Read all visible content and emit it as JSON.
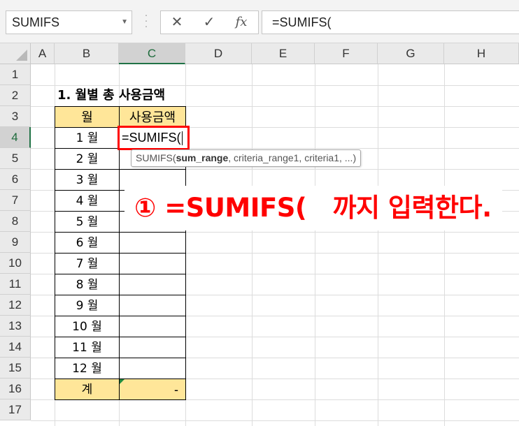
{
  "name_box": {
    "value": "SUMIFS"
  },
  "formula_bar": {
    "cancel_glyph": "✕",
    "enter_glyph": "✓",
    "fx_label": "fx",
    "value": "=SUMIFS("
  },
  "columns": [
    "A",
    "B",
    "C",
    "D",
    "E",
    "F",
    "G",
    "H"
  ],
  "rows": [
    "1",
    "2",
    "3",
    "4",
    "5",
    "6",
    "7",
    "8",
    "9",
    "10",
    "11",
    "12",
    "13",
    "14",
    "15",
    "16",
    "17"
  ],
  "sheet": {
    "title": "1. 월별 총 사용금액",
    "table_header": {
      "month": "월",
      "amount": "사용금액"
    },
    "months": [
      "1 월",
      "2 월",
      "3 월",
      "4 월",
      "5 월",
      "6 월",
      "7 월",
      "8 월",
      "9 월",
      "10 월",
      "11 월",
      "12 월"
    ],
    "total_label": "계",
    "total_value": "-",
    "editing_value": "=SUMIFS("
  },
  "tooltip": {
    "func": "SUMIFS(",
    "arg_bold": "sum_range",
    "rest": ", criteria_range1, criteria1, ...)"
  },
  "annotation": {
    "text": "① =SUMIFS(   까지 입력한다."
  },
  "colors": {
    "header_fill": "#ffe699",
    "highlight": "#ff0000",
    "excel_green": "#217346"
  }
}
